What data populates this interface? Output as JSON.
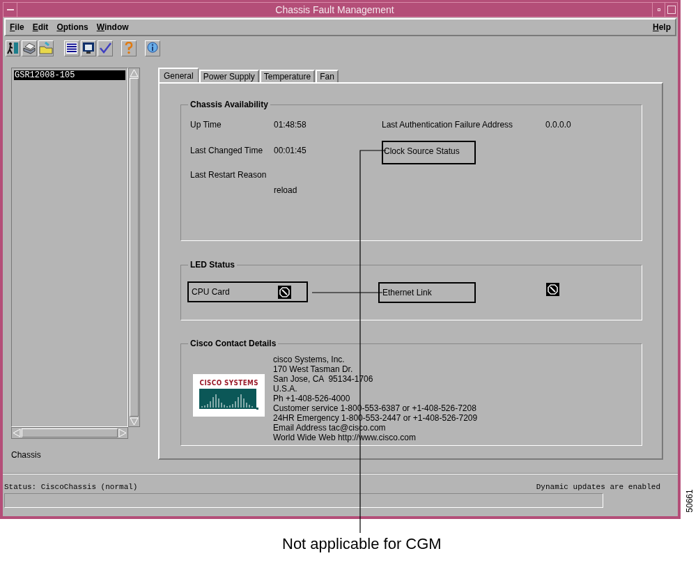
{
  "window": {
    "title": "Chassis Fault Management"
  },
  "menu": [
    {
      "label": "File"
    },
    {
      "label": "Edit"
    },
    {
      "label": "Options"
    },
    {
      "label": "Window"
    }
  ],
  "help_menu": {
    "label": "Help"
  },
  "tree": {
    "items": [
      {
        "label": "GSR12008-105",
        "selected": true
      }
    ],
    "caption": "Chassis"
  },
  "tabs": [
    {
      "label": "General",
      "selected": true
    },
    {
      "label": "Power Supply",
      "selected": false
    },
    {
      "label": "Temperature",
      "selected": false
    },
    {
      "label": "Fan",
      "selected": false
    }
  ],
  "chassis_availability": {
    "title": "Chassis Availability",
    "rows": [
      {
        "label": "Up Time",
        "value": "01:48:58",
        "right_label": "Last Authentication Failure Address",
        "right_value": "0.0.0.0",
        "right_boxed": false
      },
      {
        "label": "Last Changed Time",
        "value": "00:01:45",
        "right_label": "Clock Source Status",
        "right_boxed": true
      },
      {
        "label": "Last Restart Reason"
      }
    ],
    "restart_reason": "reload"
  },
  "led_status": {
    "title": "LED Status",
    "leds": [
      {
        "label": "CPU Card",
        "boxed": true
      },
      {
        "label": "Ethernet Link",
        "boxed": true
      }
    ]
  },
  "contact": {
    "title": "Cisco Contact Details",
    "logo_text": "CISCO SYSTEMS",
    "lines": [
      "cisco Systems, Inc.",
      "170 West Tasman Dr.",
      "San Jose, CA  95134-1706",
      "U.S.A.",
      "Ph +1-408-526-4000",
      "Customer service 1-800-553-6387 or +1-408-526-7208",
      "24HR Emergency 1-800-553-2447 or +1-408-526-7209",
      "Email Address tac@cisco.com",
      "World Wide Web http://www.cisco.com"
    ]
  },
  "status_bar": {
    "status": "Status: CiscoChassis (normal)",
    "updates": "Dynamic updates are enabled"
  },
  "annotation": {
    "callout": "Not applicable for CGM",
    "figure_number": "50661"
  }
}
